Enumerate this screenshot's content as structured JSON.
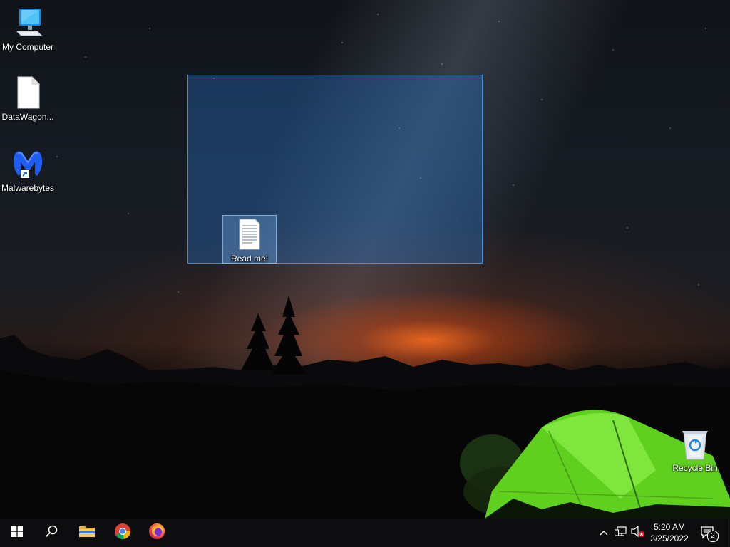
{
  "desktop": {
    "icons": [
      {
        "label": "My Computer",
        "icon": "monitor-icon"
      },
      {
        "label": "DataWagon...",
        "icon": "file-icon"
      },
      {
        "label": "Malwarebytes",
        "icon": "malwarebytes-icon"
      },
      {
        "label": "Read me!",
        "icon": "text-document-icon",
        "selected": true
      },
      {
        "label": "Recycle Bin",
        "icon": "recycle-bin-icon"
      }
    ]
  },
  "taskbar": {
    "start_icon": "windows-start-icon",
    "search_icon": "search-icon",
    "pinned": [
      {
        "name": "File Explorer",
        "icon": "folder-icon"
      },
      {
        "name": "Google Chrome",
        "icon": "chrome-icon"
      },
      {
        "name": "Firefox",
        "icon": "firefox-icon"
      }
    ],
    "tray": {
      "chevron_icon": "chevron-up-icon",
      "network_icon": "network-icon",
      "volume_icon": "volume-muted-icon",
      "time": "5:20 AM",
      "date": "3/25/2022",
      "notification_count": "2"
    }
  }
}
